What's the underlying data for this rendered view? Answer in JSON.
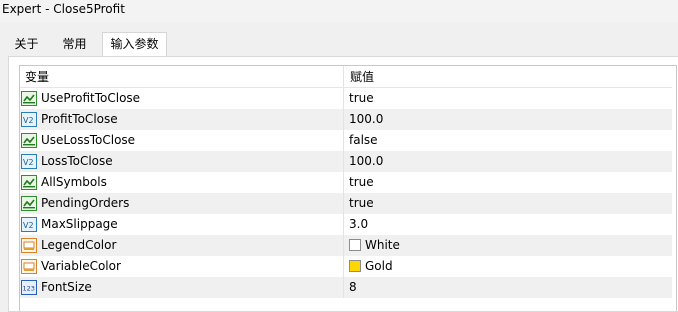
{
  "window": {
    "title": "Expert - Close5Profit"
  },
  "tabs": [
    {
      "label": "关于"
    },
    {
      "label": "常用"
    },
    {
      "label": "输入参数"
    }
  ],
  "grid": {
    "headers": {
      "variable": "变量",
      "value": "赋值"
    },
    "rows": [
      {
        "icon": "bool-icon",
        "name": "UseProfitToClose",
        "value": "true"
      },
      {
        "icon": "double-icon",
        "name": "ProfitToClose",
        "value": "100.0"
      },
      {
        "icon": "bool-icon",
        "name": "UseLossToClose",
        "value": "false"
      },
      {
        "icon": "double-icon",
        "name": "LossToClose",
        "value": "100.0"
      },
      {
        "icon": "bool-icon",
        "name": "AllSymbols",
        "value": "true"
      },
      {
        "icon": "bool-icon",
        "name": "PendingOrders",
        "value": "true"
      },
      {
        "icon": "double-icon",
        "name": "MaxSlippage",
        "value": "3.0"
      },
      {
        "icon": "color-icon",
        "name": "LegendColor",
        "value": "White",
        "swatch": "#ffffff"
      },
      {
        "icon": "color-icon",
        "name": "VariableColor",
        "value": "Gold",
        "swatch": "#ffd700"
      },
      {
        "icon": "int-icon",
        "name": "FontSize",
        "value": "8"
      }
    ]
  }
}
